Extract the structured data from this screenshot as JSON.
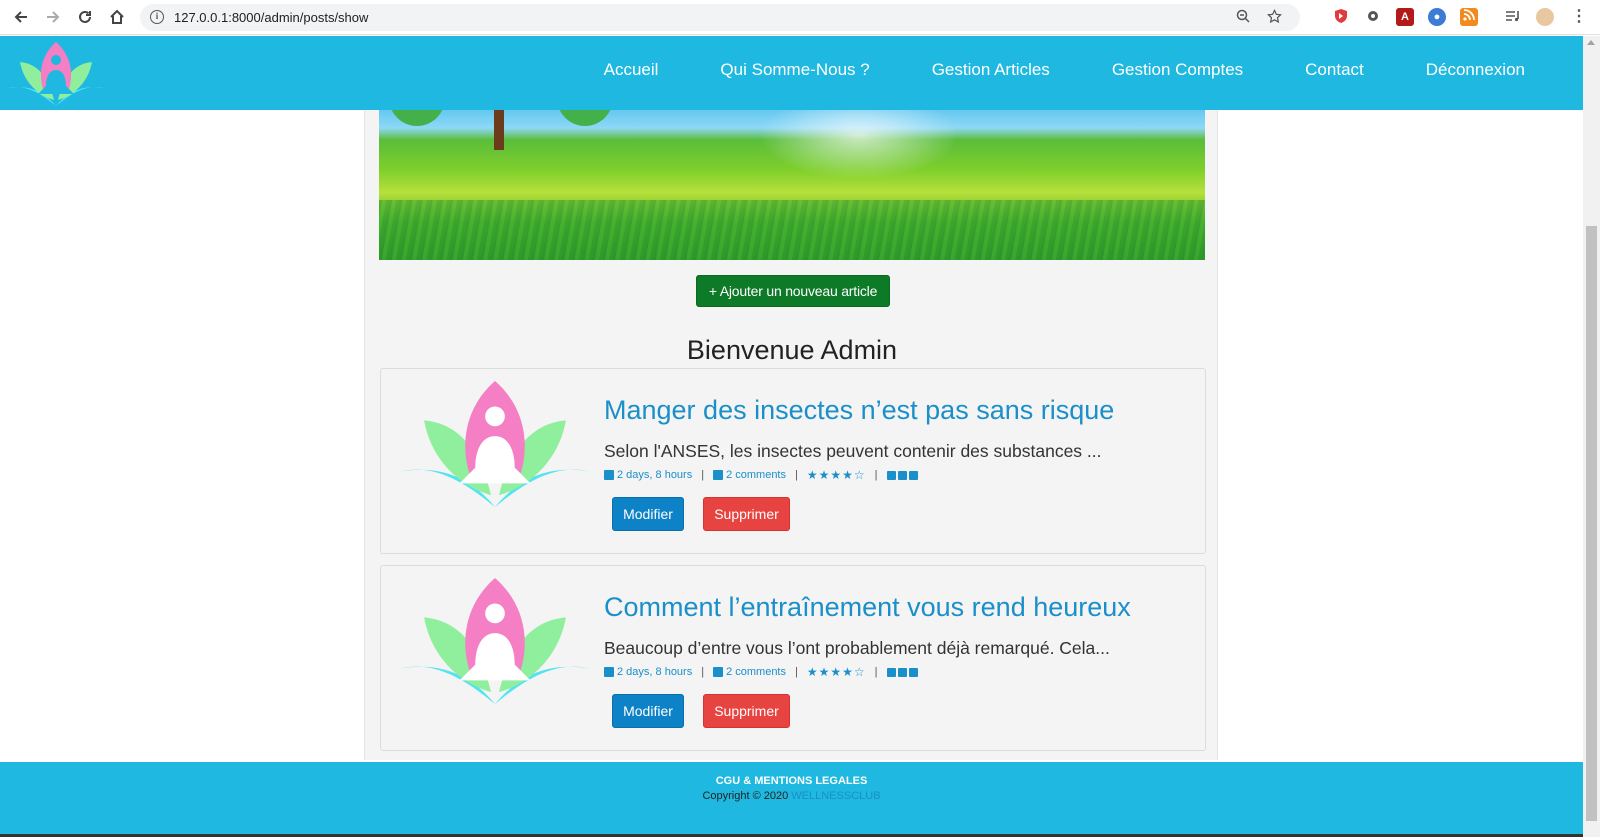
{
  "browser": {
    "url": "127.0.0.1:8000/admin/posts/show",
    "back_icon": "back-arrow-icon",
    "forward_icon": "forward-arrow-icon",
    "reload_icon": "reload-icon",
    "home_icon": "home-icon"
  },
  "header": {
    "logo": "lotus-meditation-logo",
    "nav": [
      "Accueil",
      "Qui Somme-Nous ?",
      "Gestion Articles",
      "Gestion Comptes",
      "Contact",
      "Déconnexion"
    ]
  },
  "main": {
    "add_button": "+ Ajouter un nouveau article",
    "welcome": "Bienvenue Admin",
    "posts": [
      {
        "title": "Manger des insectes n’est pas sans risque",
        "excerpt": "Selon l'ANSES, les insectes peuvent contenir des substances ...",
        "date": "2 days, 8 hours",
        "comments": "2 comments",
        "stars": "★★★★☆",
        "edit": "Modifier",
        "delete": "Supprimer"
      },
      {
        "title": "Comment l’entraînement vous rend heureux",
        "excerpt": "Beaucoup d’entre vous l’ont probablement déjà remarqué. Cela...",
        "date": "2 days, 8 hours",
        "comments": "2 comments",
        "stars": "★★★★☆",
        "edit": "Modifier",
        "delete": "Supprimer"
      }
    ]
  },
  "footer": {
    "legal": "CGU & MENTIONS LEGALES",
    "copyright": "Copyright © 2020",
    "brand": "WELLNESSCLUB"
  },
  "colors": {
    "brand": "#1eb8e0",
    "link": "#1a8fc9",
    "add_button": "#0d7a27",
    "edit_button": "#0d82c7",
    "delete_button": "#e74341"
  }
}
